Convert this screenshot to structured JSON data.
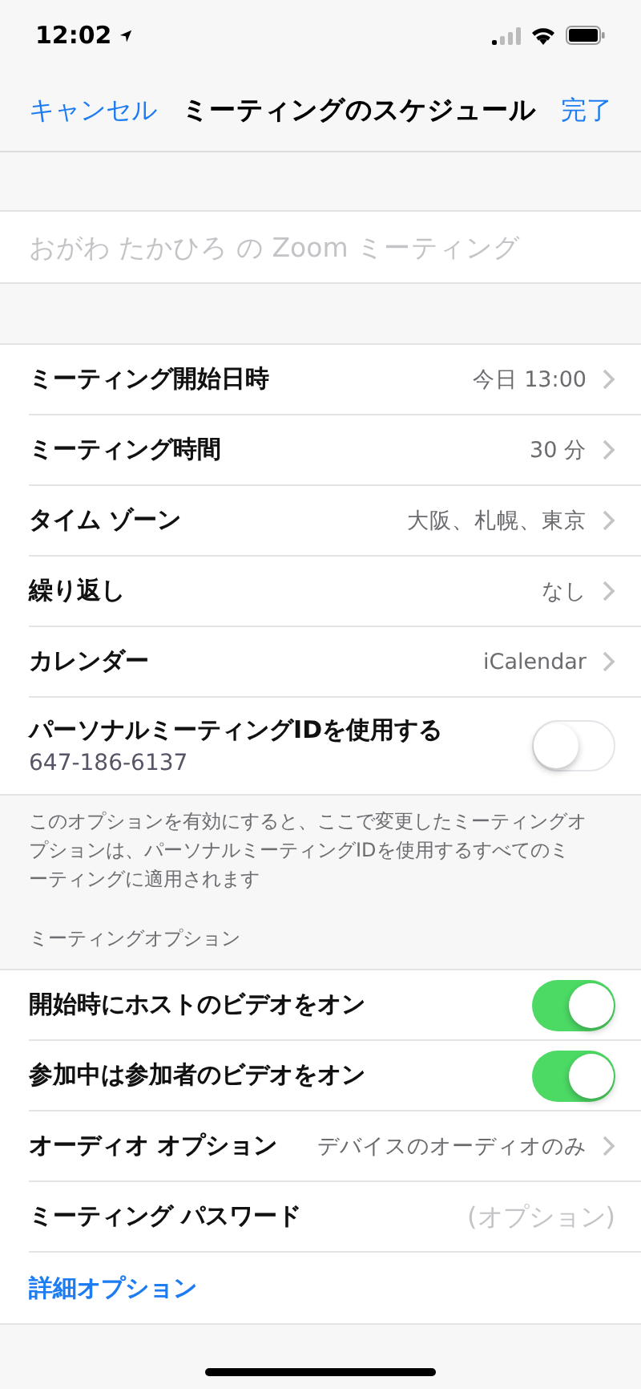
{
  "status_bar": {
    "time": "12:02"
  },
  "nav": {
    "cancel": "キャンセル",
    "title": "ミーティングのスケジュール",
    "done": "完了"
  },
  "topic": {
    "placeholder": "おがわ たかひろ の Zoom ミーティング"
  },
  "settings": [
    {
      "kind": "nav",
      "label": "ミーティング開始日時",
      "value": "今日 13:00"
    },
    {
      "kind": "nav",
      "label": "ミーティング時間",
      "value": "30 分"
    },
    {
      "kind": "nav",
      "label": "タイム ゾーン",
      "value": "大阪、札幌、東京"
    },
    {
      "kind": "nav",
      "label": "繰り返し",
      "value": "なし"
    },
    {
      "kind": "nav",
      "label": "カレンダー",
      "value": "iCalendar"
    },
    {
      "kind": "switch",
      "label": "パーソナルミーティングIDを使用する",
      "sub": "647-186-6137",
      "on": false
    }
  ],
  "settings_footer": "このオプションを有効にすると、ここで変更したミーティングオプションは、パーソナルミーティングIDを使用するすべてのミーティングに適用されます",
  "options_header": "ミーティングオプション",
  "options": [
    {
      "kind": "switch",
      "label": "開始時にホストのビデオをオン",
      "on": true
    },
    {
      "kind": "switch",
      "label": "参加中は参加者のビデオをオン",
      "on": true
    },
    {
      "kind": "nav",
      "label": "オーディオ オプション",
      "value": "デバイスのオーディオのみ"
    },
    {
      "kind": "input",
      "label": "ミーティング パスワード",
      "placeholder": "(オプション)"
    },
    {
      "kind": "link",
      "label": "詳細オプション"
    }
  ]
}
